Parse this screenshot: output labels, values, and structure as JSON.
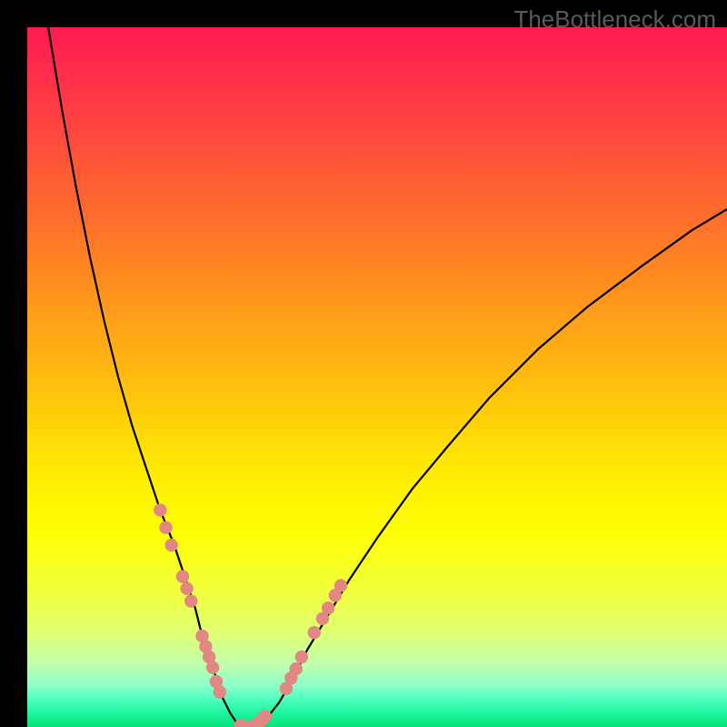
{
  "watermark": "TheBottleneck.com",
  "colors": {
    "dot_fill": "#e28782",
    "dot_stroke": "#9d4b4b",
    "curve_stroke": "#000000"
  },
  "chart_data": {
    "type": "line",
    "title": "",
    "xlabel": "",
    "ylabel": "",
    "xlim": [
      0,
      100
    ],
    "ylim": [
      0,
      100
    ],
    "series": [
      {
        "name": "bottleneck-curve",
        "x": [
          3,
          5,
          7,
          9,
          11,
          13,
          15,
          17,
          19,
          21,
          22,
          23,
          24,
          25,
          26,
          27,
          28,
          29,
          30,
          31,
          32,
          34,
          36,
          38,
          40,
          43,
          46,
          50,
          55,
          60,
          66,
          73,
          80,
          88,
          95,
          100
        ],
        "y": [
          100,
          88,
          77,
          67,
          58,
          50,
          43,
          37,
          31,
          26,
          23,
          20,
          17,
          13,
          10,
          7,
          4,
          2,
          0.5,
          0,
          0,
          1,
          3.5,
          7,
          11,
          16,
          21,
          27,
          34,
          40,
          47,
          54,
          60,
          66,
          71,
          74
        ]
      }
    ],
    "dots": [
      {
        "x": 19.0,
        "y": 31.0
      },
      {
        "x": 19.8,
        "y": 28.5
      },
      {
        "x": 20.6,
        "y": 26.0
      },
      {
        "x": 22.2,
        "y": 21.5
      },
      {
        "x": 22.8,
        "y": 19.8
      },
      {
        "x": 23.4,
        "y": 18.0
      },
      {
        "x": 25.0,
        "y": 13.0
      },
      {
        "x": 25.5,
        "y": 11.5
      },
      {
        "x": 26.0,
        "y": 10.0
      },
      {
        "x": 26.5,
        "y": 8.5
      },
      {
        "x": 27.0,
        "y": 6.5
      },
      {
        "x": 27.5,
        "y": 5.0
      },
      {
        "x": 30.5,
        "y": 0.2
      },
      {
        "x": 31.0,
        "y": 0.0
      },
      {
        "x": 31.5,
        "y": 0.0
      },
      {
        "x": 32.0,
        "y": 0.0
      },
      {
        "x": 32.5,
        "y": 0.2
      },
      {
        "x": 33.0,
        "y": 0.5
      },
      {
        "x": 33.5,
        "y": 1.0
      },
      {
        "x": 34.0,
        "y": 1.5
      },
      {
        "x": 37.0,
        "y": 5.5
      },
      {
        "x": 37.7,
        "y": 7.0
      },
      {
        "x": 38.4,
        "y": 8.3
      },
      {
        "x": 39.2,
        "y": 10.0
      },
      {
        "x": 41.0,
        "y": 13.5
      },
      {
        "x": 42.2,
        "y": 15.5
      },
      {
        "x": 43.0,
        "y": 17.0
      },
      {
        "x": 44.0,
        "y": 18.8
      },
      {
        "x": 44.8,
        "y": 20.2
      }
    ]
  }
}
